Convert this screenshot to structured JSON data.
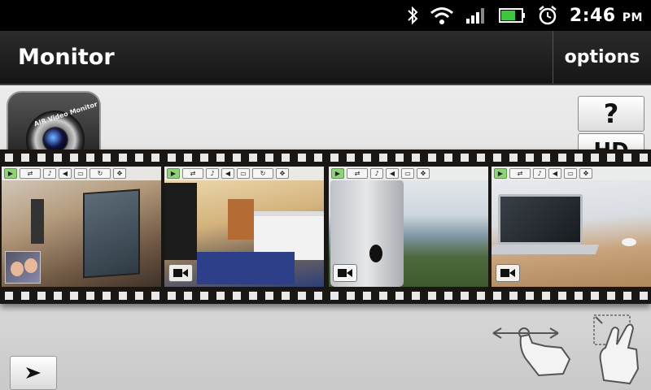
{
  "status_bar": {
    "time": "2:46",
    "ampm": "PM",
    "icons": [
      "bluetooth-icon",
      "wifi-icon",
      "signal-icon",
      "battery-icon",
      "alarm-icon"
    ]
  },
  "action_bar": {
    "title": "Monitor",
    "options_label": "options"
  },
  "logo": {
    "text": "AIR Video Monitor"
  },
  "side_buttons": {
    "help_label": "?",
    "hd_label": "HD"
  },
  "film_strip": {
    "frames": [
      {
        "name": "camera-feed-1",
        "scene": "living-room-with-tablet",
        "has_pip": true
      },
      {
        "name": "camera-feed-2",
        "scene": "kids-bedroom"
      },
      {
        "name": "camera-feed-3",
        "scene": "window-view-with-tablet"
      },
      {
        "name": "camera-feed-4",
        "scene": "desk-with-laptop"
      }
    ],
    "frame_toolbar_icons": [
      "video-icon",
      "switch-camera-icon",
      "microphone-icon",
      "speaker-icon",
      "no-screen-icon",
      "rotate-icon",
      "fullscreen-icon"
    ]
  },
  "colors": {
    "status_bar": "#000000",
    "action_bar": "#1c1c1c",
    "film": "#1a1613",
    "active_green": "#8fd27a"
  }
}
